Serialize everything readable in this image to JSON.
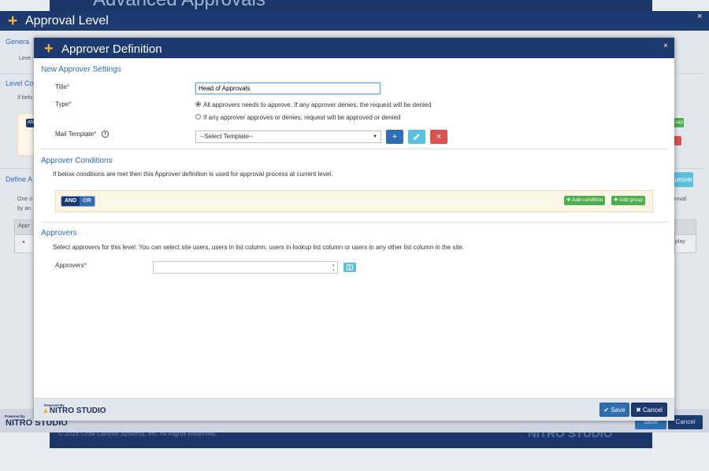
{
  "colors": {
    "titlebar": "#1c3a70",
    "accent_plus": "#f4b23b",
    "heading_blue": "#2e6bb5",
    "primary_button": "#2f6fb1",
    "info_button": "#5bc0de",
    "danger_button": "#d9534f",
    "success_button": "#4cae4c",
    "condition_panel": "#fdf6e6"
  },
  "background_app": {
    "header_title": "Advanced Approvals",
    "footer_text": "© 2018 Crow Canyon Systems, Inc. All Rights Reserved.",
    "footer_logo": "NITRO STUDIO"
  },
  "outer_dialog": {
    "title": "Approval Level",
    "close_icon": "×",
    "fragments": {
      "general": "Genera",
      "level": "Leve",
      "level_conditions": "Level Co",
      "if_below": "If belo",
      "and": "AN",
      "define": "Define A",
      "one": "One o",
      "by_any": "by an",
      "appr": "Appr",
      "right_sap": "sap",
      "right_approver": "prover",
      "right_roval": "roval",
      "right_play": "play"
    },
    "footer": {
      "powered": "Powered By",
      "logo": "NITRO STUDIO",
      "save": "Save",
      "cancel": "Cancel"
    }
  },
  "dialog": {
    "title": "Approver Definition",
    "close_icon": "×",
    "settings": {
      "heading": "New Approver Settings",
      "title_label": "Title",
      "title_value": "Head of Approvals",
      "type_label": "Type",
      "type_options": [
        {
          "label": "All approvers needs to approve. If any approver denies, the request will be denied",
          "selected": true
        },
        {
          "label": "If any approver approves or denies, request will be approved or denied",
          "selected": false
        }
      ],
      "mail_template_label": "Mail Template",
      "info_icon": "i",
      "mail_template_selected": "--Select Template--",
      "add_icon": "+",
      "edit_icon": "pencil",
      "delete_icon": "×"
    },
    "conditions": {
      "heading": "Approver Conditions",
      "description": "If below conditions are met then this Approver definition is used for approval process at current level.",
      "and_label": "AND",
      "or_label": "OR",
      "add_condition": "Add condition",
      "add_group": "Add group"
    },
    "approvers": {
      "heading": "Approvers",
      "description": "Select approvers for this level. You can select site users, users in list column, users in lookup list column or users in any other list column in the site.",
      "label": "Approvers",
      "picker_icon": "address-book"
    },
    "footer": {
      "powered_by": "Powered By",
      "logo": "NITRO STUDIO",
      "save": "Save",
      "cancel": "Cancel"
    }
  }
}
